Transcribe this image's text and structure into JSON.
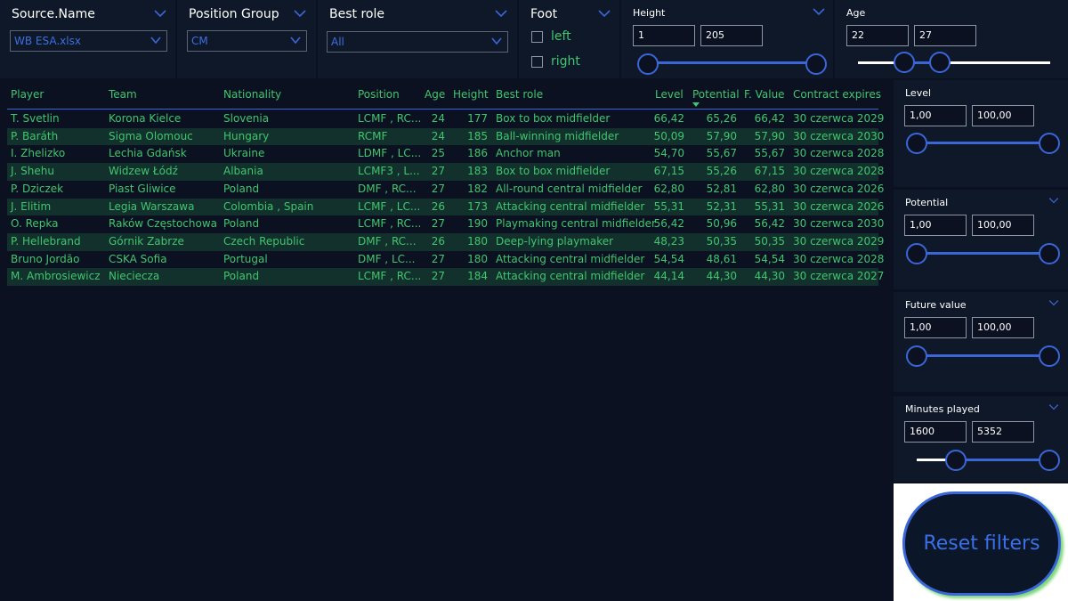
{
  "slicers": {
    "source": {
      "title": "Source.Name",
      "value": "WB ESA.xlsx"
    },
    "position_group": {
      "title": "Position Group",
      "value": "CM"
    },
    "best_role": {
      "title": "Best role",
      "value": "All"
    },
    "foot": {
      "title": "Foot",
      "options": [
        "left",
        "right"
      ]
    },
    "height": {
      "title": "Height",
      "min": "1",
      "max": "205"
    },
    "age": {
      "title": "Age",
      "min": "22",
      "max": "27"
    },
    "level": {
      "title": "Level",
      "min": "1,00",
      "max": "100,00"
    },
    "potential": {
      "title": "Potential",
      "min": "1,00",
      "max": "100,00"
    },
    "future_value": {
      "title": "Future value",
      "min": "1,00",
      "max": "100,00"
    },
    "minutes_played": {
      "title": "Minutes played",
      "min": "1600",
      "max": "5352"
    }
  },
  "table": {
    "columns": [
      "Player",
      "Team",
      "Nationality",
      "Position",
      "Age",
      "Height",
      "Best role",
      "Level",
      "Potential",
      "F. Value",
      "Contract expires"
    ],
    "rows": [
      [
        "T. Svetlin",
        "Korona Kielce",
        "Slovenia",
        "LCMF , RC...",
        "24",
        "177",
        "Box to box midfielder",
        "66,42",
        "65,26",
        "66,42",
        "30 czerwca 2029"
      ],
      [
        "P. Baráth",
        "Sigma Olomouc",
        "Hungary",
        "RCMF",
        "24",
        "185",
        "Ball-winning midfielder",
        "50,09",
        "57,90",
        "57,90",
        "30 czerwca 2030"
      ],
      [
        "I. Zhelizko",
        "Lechia Gdańsk",
        "Ukraine",
        "LDMF , LC...",
        "25",
        "186",
        "Anchor man",
        "54,70",
        "55,67",
        "55,67",
        "30 czerwca 2028"
      ],
      [
        "J. Shehu",
        "Widzew Łódź",
        "Albania",
        "LCMF3 , L...",
        "27",
        "183",
        "Box to box midfielder",
        "67,15",
        "55,26",
        "67,15",
        "30 czerwca 2028"
      ],
      [
        "P. Dziczek",
        "Piast Gliwice",
        "Poland",
        "DMF , RC...",
        "27",
        "182",
        "All-round central midfielder",
        "62,80",
        "52,81",
        "62,80",
        "30 czerwca 2026"
      ],
      [
        "J. Elitim",
        "Legia Warszawa",
        "Colombia , Spain",
        "LCMF , LC...",
        "26",
        "173",
        "Attacking central midfielder",
        "55,31",
        "52,31",
        "55,31",
        "30 czerwca 2026"
      ],
      [
        "O. Repka",
        "Raków Częstochowa",
        "Poland",
        "LCMF , RC...",
        "27",
        "190",
        "Playmaking central midfielder",
        "56,42",
        "50,96",
        "56,42",
        "30 czerwca 2030"
      ],
      [
        "P. Hellebrand",
        "Górnik Zabrze",
        "Czech Republic",
        "DMF , RC...",
        "26",
        "180",
        "Deep-lying playmaker",
        "48,23",
        "50,35",
        "50,35",
        "30 czerwca 2029"
      ],
      [
        "Bruno Jordão",
        "CSKA Sofia",
        "Portugal",
        "DMF , LC...",
        "27",
        "180",
        "Attacking central midfielder",
        "54,54",
        "48,61",
        "54,54",
        "30 czerwca 2028"
      ],
      [
        "M. Ambrosiewicz",
        "Nieciecza",
        "Poland",
        "LCMF , RC...",
        "27",
        "184",
        "Attacking central midfielder",
        "44,14",
        "44,30",
        "44,30",
        "30 czerwca 2027"
      ]
    ]
  },
  "reset_button": {
    "label": "Reset filters"
  },
  "colors": {
    "background": "#0b1120",
    "accent_blue": "#3a66d8",
    "text_green": "#3fc66e",
    "alt_row": "#12302c"
  },
  "icons": [
    "chevron-down-icon",
    "sort-desc-icon"
  ]
}
